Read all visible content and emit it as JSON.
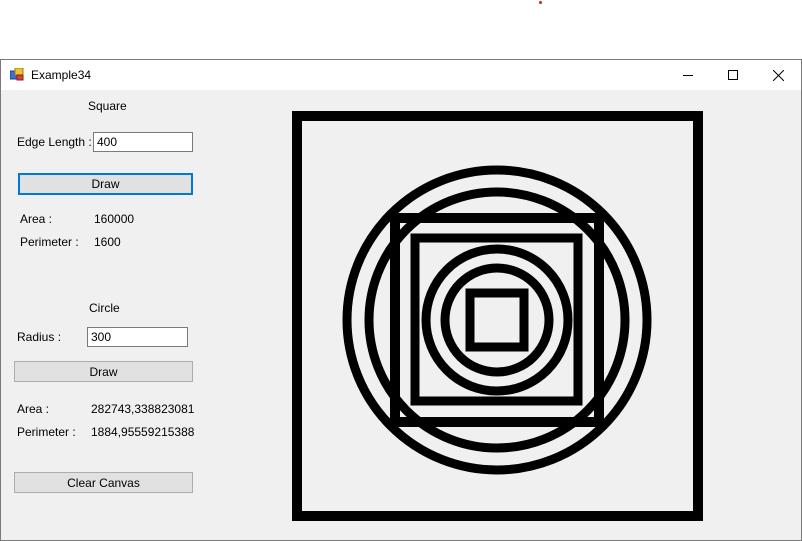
{
  "window": {
    "title": "Example34"
  },
  "controls": {
    "minimize": "minimize",
    "maximize": "maximize",
    "close": "close"
  },
  "square": {
    "heading": "Square",
    "edge_label": "Edge Length :",
    "edge_value": "400",
    "draw_label": "Draw",
    "area_label": "Area :",
    "area_value": "160000",
    "perimeter_label": "Perimeter :",
    "perimeter_value": "1600"
  },
  "circle": {
    "heading": "Circle",
    "radius_label": "Radius :",
    "radius_value": "300",
    "draw_label": "Draw",
    "area_label": "Area :",
    "area_value": "282743,338823081",
    "perimeter_label": "Perimeter :",
    "perimeter_value": "1884,95559215388"
  },
  "clear_label": "Clear Canvas",
  "canvas": {
    "stroke_color": "#000000",
    "background": "#f0f0f0"
  }
}
